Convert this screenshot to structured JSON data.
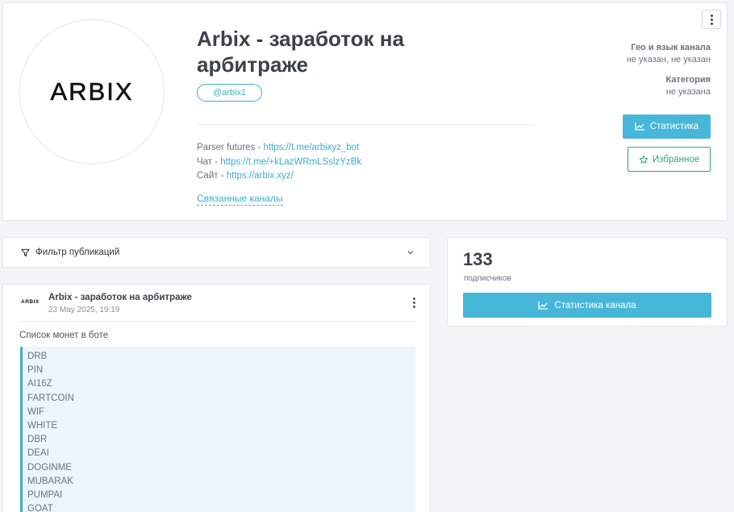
{
  "channel": {
    "title": "Arbix - заработок на арбитраже",
    "handle": "@arbix1",
    "logo_text": "ARBIX",
    "description": [
      {
        "prefix": "Parser futures - ",
        "link": "https://t.me/arbixyz_bot"
      },
      {
        "prefix": "Чат - ",
        "link": "https://t.me/+kLazWRmLSslzYzBk"
      },
      {
        "prefix": "Сайт - ",
        "link": "https://arbix.xyz/"
      }
    ],
    "related_link": "Связанные каналы",
    "geo_label": "Гео и язык канала",
    "geo_value": "не указан, не указан",
    "category_label": "Категория",
    "category_value": "не указана",
    "stats_button": "Статистика",
    "favorite_button": "Избранное"
  },
  "filter": {
    "label": "Фильтр публикаций"
  },
  "stats": {
    "subscribers": "133",
    "subscribers_label": "подписчиков",
    "channel_stats_button": "Статистика канала"
  },
  "post": {
    "avatar_text": "ARBIX",
    "author": "Arbix - заработок на арбитраже",
    "date": "23 May 2025, 19:19",
    "text": "Список монет в боте",
    "coins": [
      "DRB",
      "PIN",
      "AI16Z",
      "FARTCOIN",
      "WIF",
      "WHITE",
      "DBR",
      "DEAI",
      "DOGINME",
      "MUBARAK",
      "PUMPAI",
      "GOAT"
    ]
  },
  "colors": {
    "accent": "#46b7d9",
    "link": "#3aaecb",
    "favorite": "#2fa877",
    "background": "#f3f5f7"
  }
}
